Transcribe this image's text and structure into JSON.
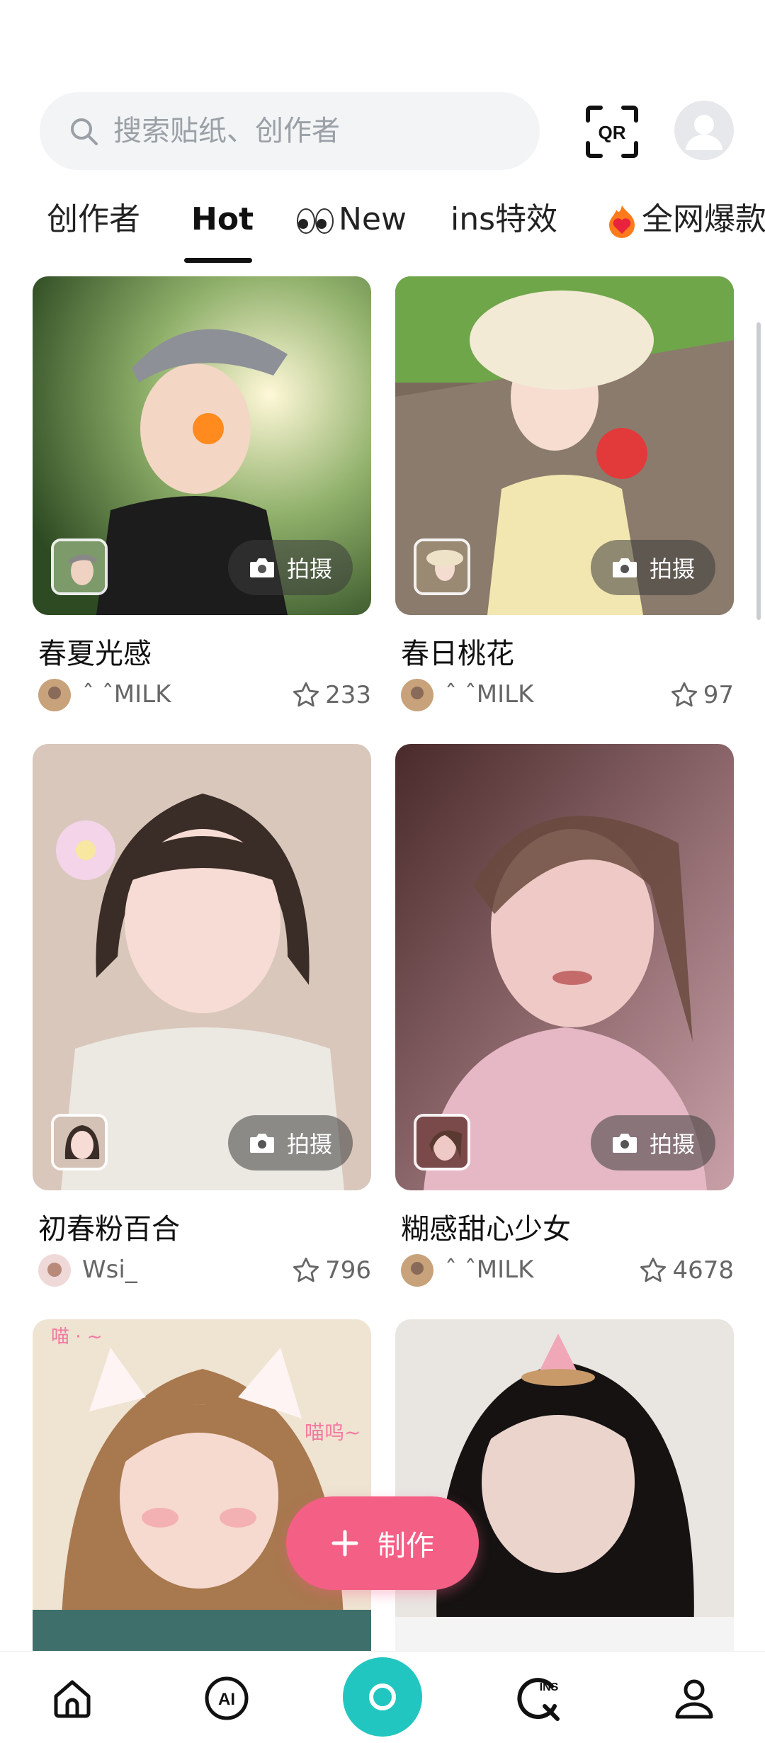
{
  "search": {
    "placeholder": "搜索贴纸、创作者"
  },
  "header": {
    "qr_label": "QR"
  },
  "tabs": [
    {
      "label": "创作者"
    },
    {
      "label": "Hot",
      "active": true
    },
    {
      "label": "New",
      "icon": "eyes-emoji"
    },
    {
      "label": "ins特效"
    },
    {
      "label": "全网爆款",
      "icon": "flame-heart-emoji"
    }
  ],
  "cards": [
    {
      "title": "春夏光感",
      "user": "ˆ ˆMILK",
      "stars": "233",
      "shoot_label": "拍摄"
    },
    {
      "title": "春日桃花",
      "user": "ˆ ˆMILK",
      "stars": "97",
      "shoot_label": "拍摄"
    },
    {
      "title": "初春粉百合",
      "user": "Wsi_",
      "stars": "796",
      "shoot_label": "拍摄"
    },
    {
      "title": "糊感甜心少女",
      "user": "ˆ ˆMILK",
      "stars": "4678",
      "shoot_label": "拍摄"
    },
    {
      "title": "",
      "user": "",
      "stars": "",
      "shoot_label": ""
    },
    {
      "title": "",
      "user": "",
      "stars": "",
      "shoot_label": ""
    }
  ],
  "overlay_texts": {
    "meow_top": "喵 · ~",
    "meow_right": "喵呜~"
  },
  "create_button": {
    "label": "制作"
  },
  "bottom_nav": [
    {
      "name": "home",
      "icon": "home-icon"
    },
    {
      "name": "ai",
      "icon": "ai-icon",
      "label": "AI"
    },
    {
      "name": "camera",
      "icon": "camera-icon"
    },
    {
      "name": "ins",
      "icon": "ins-search-icon",
      "label": "INS"
    },
    {
      "name": "profile",
      "icon": "profile-icon"
    }
  ],
  "colors": {
    "accent_pink": "#f45f86",
    "camera_teal": "#22c6c0",
    "search_bg": "#f2f4f6"
  }
}
